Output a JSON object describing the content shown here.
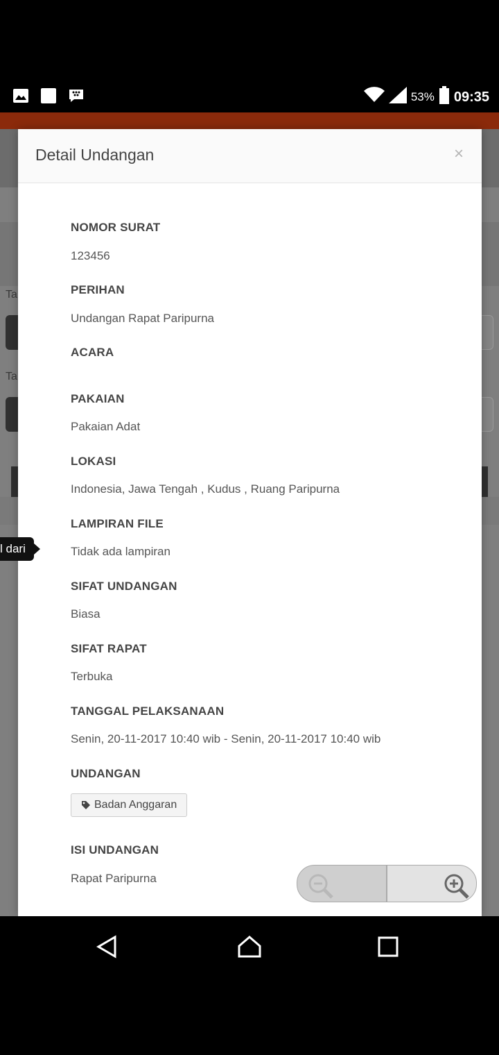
{
  "status_bar": {
    "battery_percent": "53%",
    "time": "09:35",
    "left_icons": [
      "image-icon",
      "square-icon",
      "bbm-icon"
    ],
    "right_icons": [
      "wifi-icon",
      "signal-icon",
      "battery-icon"
    ]
  },
  "background": {
    "labels": [
      "Ta",
      "Ta"
    ],
    "tooltip": "l dari"
  },
  "modal": {
    "title": "Detail Undangan",
    "close": "×",
    "fields": [
      {
        "label": "NOMOR SURAT",
        "value": "123456"
      },
      {
        "label": "PERIHAN",
        "value": "Undangan Rapat Paripurna"
      },
      {
        "label": "ACARA",
        "value": ""
      },
      {
        "label": "PAKAIAN",
        "value": "Pakaian Adat"
      },
      {
        "label": "LOKASI",
        "value": "Indonesia, Jawa Tengah , Kudus , Ruang Paripurna"
      },
      {
        "label": "LAMPIRAN FILE",
        "value": "Tidak ada lampiran"
      },
      {
        "label": "SIFAT UNDANGAN",
        "value": "Biasa"
      },
      {
        "label": "SIFAT RAPAT",
        "value": "Terbuka"
      },
      {
        "label": "TANGGAL PELAKSANAAN",
        "value": "Senin, 20-11-2017 10:40 wib - Senin, 20-11-2017 10:40 wib"
      },
      {
        "label": "UNDANGAN",
        "value": ""
      },
      {
        "label": "ISI UNDANGAN",
        "value": "Rapat Paripurna"
      }
    ],
    "undangan_tag": "Badan Anggaran"
  },
  "zoom_controls": {
    "zoom_out_icon": "zoom-out-icon",
    "zoom_in_icon": "zoom-in-icon"
  },
  "nav_bar": {
    "icons": [
      "back-icon",
      "home-icon",
      "recents-icon"
    ]
  }
}
